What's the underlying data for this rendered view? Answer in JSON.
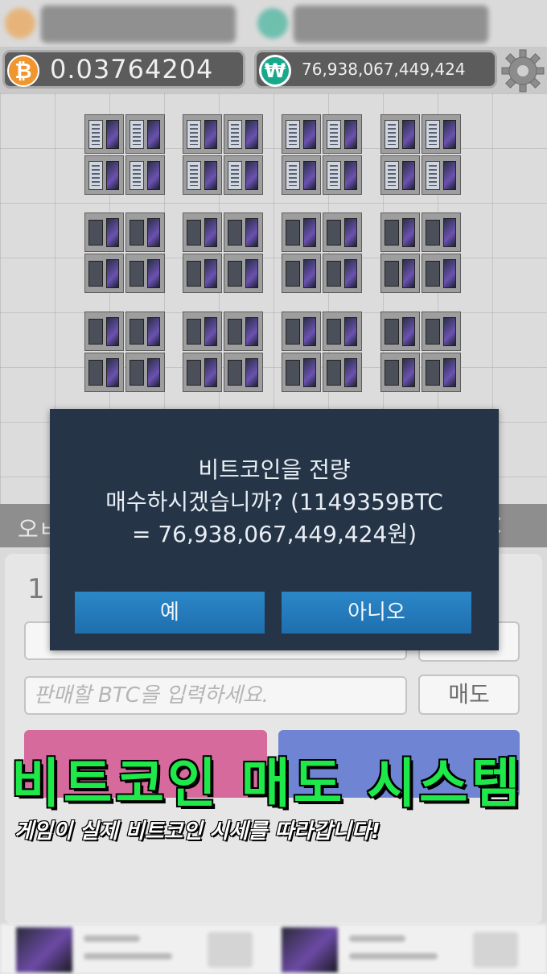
{
  "currency_bar": {
    "btc_balance": "0.03764204",
    "krw_balance": "76,938,067,449,424",
    "btc_icon": "bitcoin-coin-icon",
    "krw_icon": "won-coin-icon",
    "btc_symbol": "₿",
    "krw_symbol": "₩",
    "settings_icon": "gear-icon"
  },
  "farm": {
    "rows": [
      {
        "style": "server-rack"
      },
      {
        "style": "open-cabinet"
      },
      {
        "style": "mining-rig"
      }
    ],
    "columns": 4
  },
  "tabs": {
    "left_fragment": "오ㅂ",
    "right_fragment": "C"
  },
  "panel": {
    "count": "1",
    "sell_input_placeholder": "판매할 BTC을 입력하세요.",
    "sell_button": "매도"
  },
  "dialog": {
    "line1": "비트코인을 전량",
    "line2": "매수하시겠습니까? (1149359BTC",
    "line3": "= 76,938,067,449,424원)",
    "yes_label": "예",
    "no_label": "아니오"
  },
  "promo": {
    "title": "비트코인 매도 시스템",
    "subtitle": "게임이 실제 비트코인 시세를 따라갑니다!"
  },
  "colors": {
    "dialog_bg": "#253446",
    "dialog_button": "#2280c0",
    "promo_title": "#1ee84a",
    "btc_orange": "#f0962e",
    "krw_green": "#18a98c"
  }
}
